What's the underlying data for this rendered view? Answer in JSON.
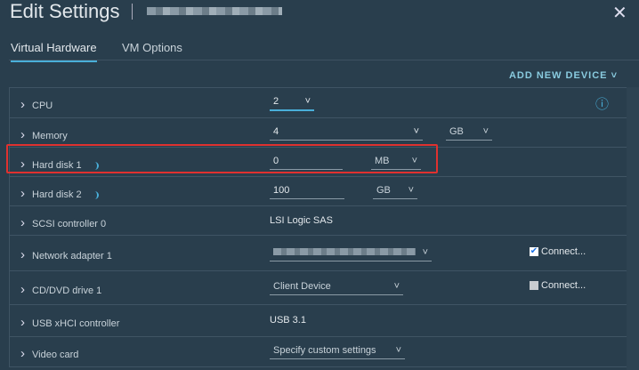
{
  "header": {
    "title": "Edit Settings",
    "close": "✕"
  },
  "tabs": [
    {
      "label": "Virtual Hardware"
    },
    {
      "label": "VM Options"
    }
  ],
  "add_device": "ADD NEW DEVICE ˅",
  "rows": [
    {
      "label": "CPU",
      "value": "2"
    },
    {
      "label": "Memory",
      "value": "4",
      "unit": "GB"
    },
    {
      "label": "Hard disk 1",
      "value": "0",
      "unit": "MB"
    },
    {
      "label": "Hard disk 2",
      "value": "100",
      "unit": "GB"
    },
    {
      "label": "SCSI controller 0",
      "value": "LSI Logic SAS"
    },
    {
      "label": "Network adapter 1",
      "connect": "Connect..."
    },
    {
      "label": "CD/DVD drive 1",
      "value": "Client Device",
      "connect": "Connect..."
    },
    {
      "label": "USB xHCI controller",
      "value": "USB 3.1"
    },
    {
      "label": "Video card",
      "value": "Specify custom settings"
    }
  ],
  "chev": "˅",
  "info": "ⓘ"
}
